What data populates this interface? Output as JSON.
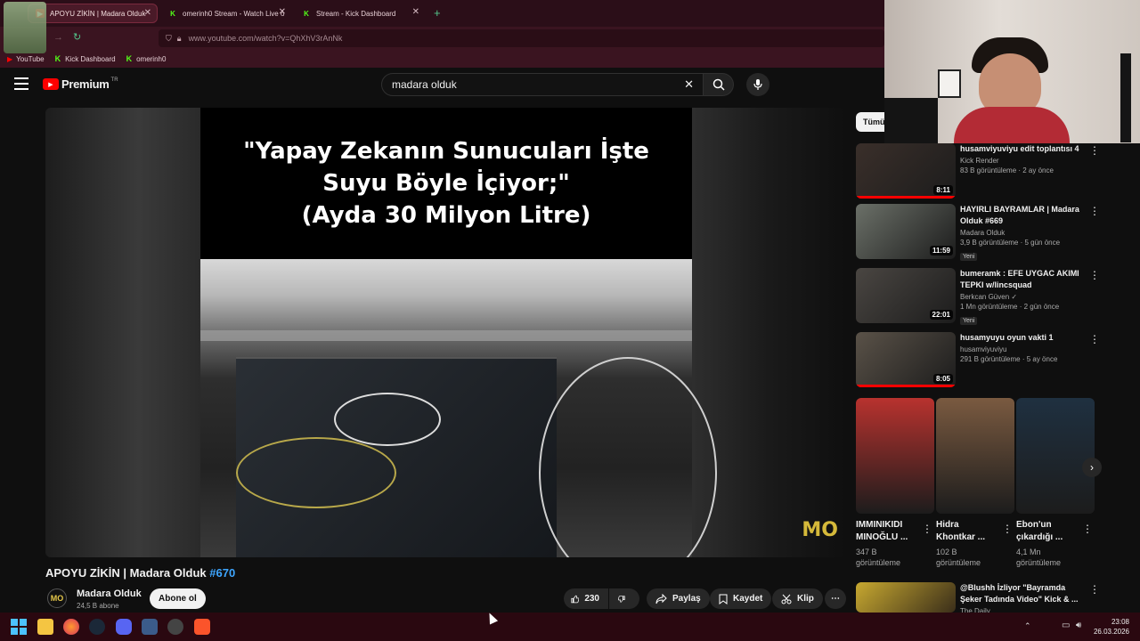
{
  "browser": {
    "tabs": [
      {
        "label": "APOYU ZİKİN | Madara Olduk",
        "active": true
      },
      {
        "label": "omerinh0 Stream - Watch Live o",
        "active": false
      },
      {
        "label": "Stream - Kick Dashboard",
        "active": false
      }
    ],
    "url": "www.youtube.com/watch?v=QhXhV3rAnNk",
    "bookmarks": [
      "YouTube",
      "Kick Dashboard",
      "omerinh0"
    ]
  },
  "youtube": {
    "logo_text": "Premium",
    "logo_region": "TR",
    "search_value": "madara olduk",
    "filter_chip": "Tümü"
  },
  "video": {
    "caption_lines": [
      "\"Yapay Zekanın Sunucuları İşte",
      "Suyu Böyle İçiyor;\"",
      "(Ayda 30 Milyon Litre)"
    ],
    "watermark": "MO",
    "title": "APOYU ZİKİN | Madara Olduk",
    "hashtag": "#670",
    "channel_name": "Madara Olduk",
    "channel_avatar": "MO",
    "subscribers": "24,5 B abone",
    "subscribe_label": "Abone ol",
    "like_count": "230",
    "share_label": "Paylaş",
    "save_label": "Kaydet",
    "clip_label": "Klip"
  },
  "recommendations": [
    {
      "title": "husamviyuviyu edit toplantısı 4",
      "channel": "Kick Render",
      "meta": "83 B görüntüleme · 2 ay önce",
      "duration": "8:11",
      "badge": "",
      "thumb_color": "#3a2f2a"
    },
    {
      "title": "HAYIRLI BAYRAMLAR | Madara Olduk #669",
      "channel": "Madara Olduk",
      "meta": "3,9 B görüntüleme · 5 gün önce",
      "duration": "11:59",
      "badge": "Yeni",
      "thumb_color": "#6b7068"
    },
    {
      "title": "bumeramk : EFE UYGAC AKIMI TEPKI w/lincsquad",
      "channel": "Berkcan Güven ✓",
      "meta": "1 Mn görüntüleme · 2 gün önce",
      "duration": "22:01",
      "badge": "Yeni",
      "thumb_color": "#4a4642"
    },
    {
      "title": "husamyuyu oyun vakti 1",
      "channel": "husamviyuviyu",
      "meta": "291 B görüntüleme · 5 ay önce",
      "duration": "8:05",
      "badge": "",
      "thumb_color": "#5a5248"
    }
  ],
  "shorts": [
    {
      "title": "IMMINIKIDI MINOĞLU ...",
      "views": "347 B görüntüleme",
      "thumb_color": "#b8322e"
    },
    {
      "title": "Hidra Khontkar ...",
      "views": "102 B görüntüleme",
      "thumb_color": "#7a5a40"
    },
    {
      "title": "Ebon'un çıkardığı ...",
      "views": "4,1 Mn görüntüleme",
      "thumb_color": "#1f3040"
    }
  ],
  "bottom_rec": {
    "title": "@Blushh İzliyor \"Bayramda Şeker Tadında Video\" Kick & ...",
    "channel": "The Daily",
    "thumb_color": "#c7a830"
  },
  "taskbar": {
    "time": "23:08",
    "date": "26.03.2026"
  }
}
